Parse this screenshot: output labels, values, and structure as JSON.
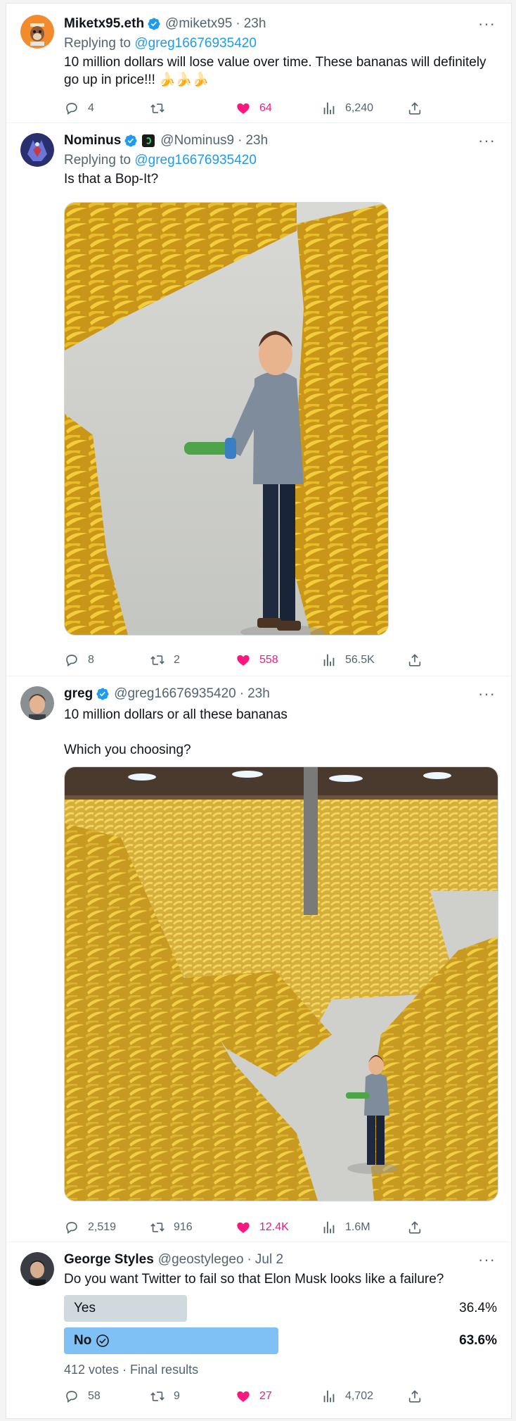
{
  "colors": {
    "link": "#1d9bf0",
    "like": "#f91880",
    "muted": "#536471",
    "poll_winner": "#7fc1f5",
    "poll_loser": "#cfd9de"
  },
  "tweets": [
    {
      "display_name": "Miketx95.eth",
      "handle": "@miketx95",
      "time": "23h",
      "replying_prefix": "Replying to ",
      "replying_to": "@greg16676935420",
      "text": "10 million dollars will lose value over time. These bananas will definitely go up in price!!! 🍌🍌🍌",
      "replies": "4",
      "retweets": "",
      "likes": "64",
      "views": "6,240"
    },
    {
      "display_name": "Nominus",
      "handle": "@Nominus9",
      "time": "23h",
      "replying_prefix": "Replying to ",
      "replying_to": "@greg16676935420",
      "text": "Is that a Bop-It?",
      "replies": "8",
      "retweets": "2",
      "likes": "558",
      "views": "56.5K"
    },
    {
      "display_name": "greg",
      "handle": "@greg16676935420",
      "time": "23h",
      "text": "10 million dollars or all these bananas\n\nWhich you choosing?",
      "replies": "2,519",
      "retweets": "916",
      "likes": "12.4K",
      "views": "1.6M"
    },
    {
      "display_name": "George Styles",
      "handle": "@geostylegeo",
      "time": "Jul 2",
      "text": "Do you want Twitter to fail so that Elon Musk looks like a failure?",
      "poll": {
        "options": [
          {
            "label": "Yes",
            "percent_text": "36.4%",
            "percent": 36.4,
            "winner": false
          },
          {
            "label": "No",
            "percent_text": "63.6%",
            "percent": 63.6,
            "winner": true
          }
        ],
        "footer": "412 votes · Final results"
      },
      "replies": "58",
      "retweets": "9",
      "likes": "27",
      "views": "4,702"
    }
  ],
  "icons": [
    "verified-badge-icon",
    "more-icon",
    "reply-icon",
    "retweet-icon",
    "like-icon",
    "views-icon",
    "share-icon"
  ]
}
